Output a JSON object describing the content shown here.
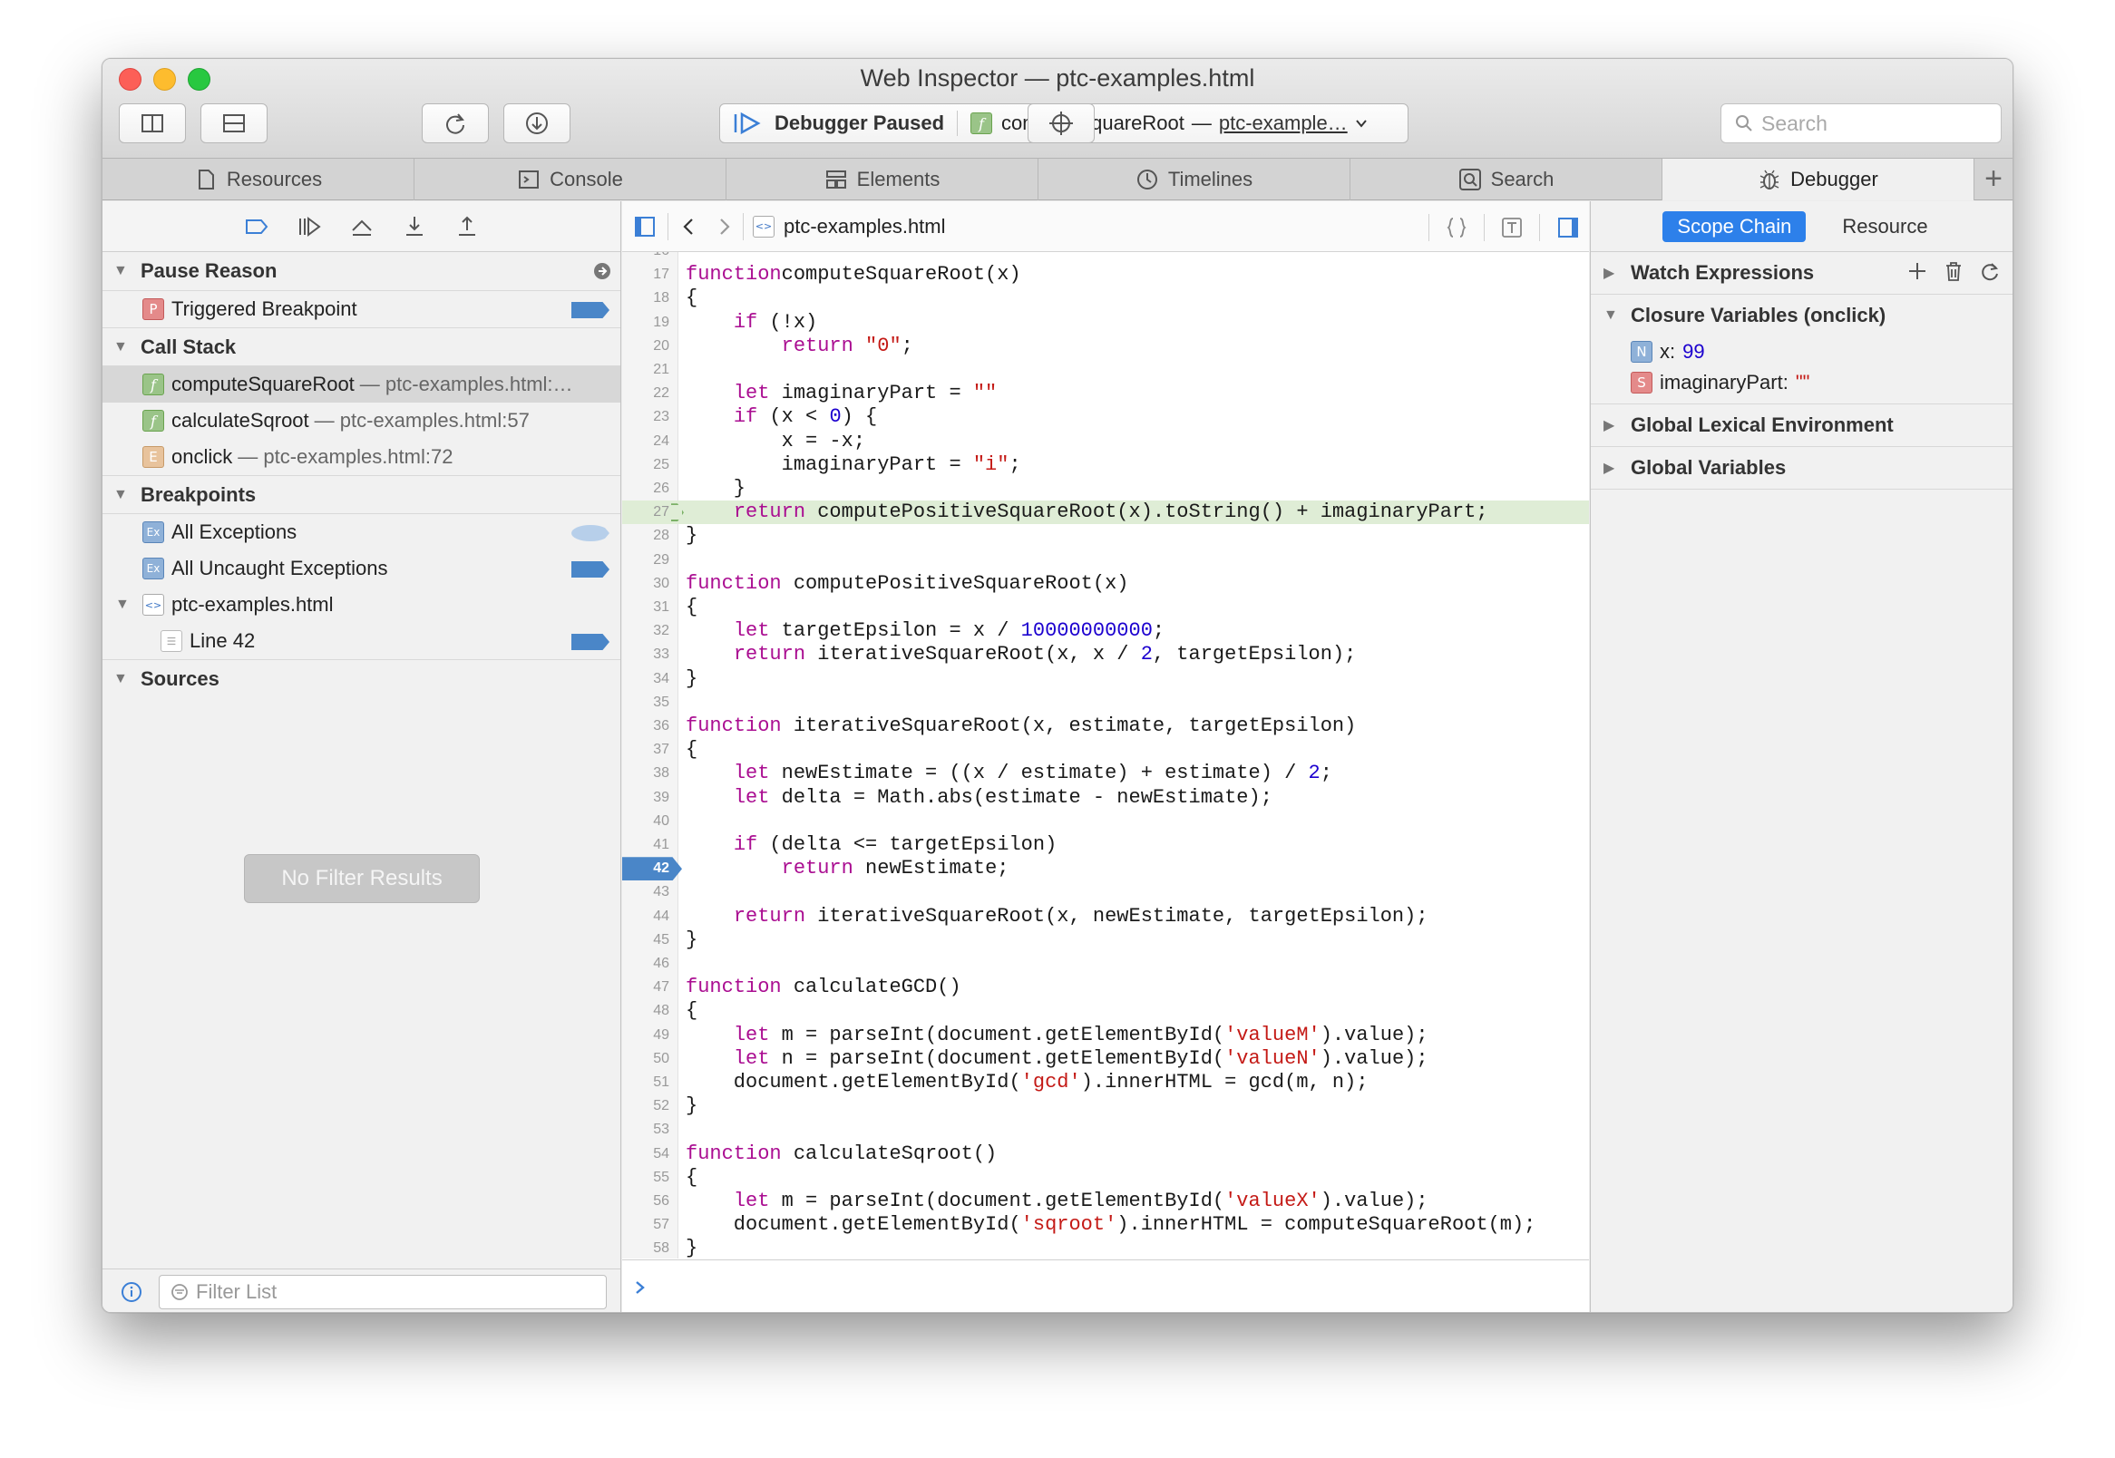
{
  "window": {
    "title": "Web Inspector — ptc-examples.html"
  },
  "toolbar": {
    "debugger_status": "Debugger Paused",
    "current_function": "computeSquareRoot",
    "current_file": "ptc-example…",
    "search_placeholder": "Search"
  },
  "tabs": [
    {
      "label": "Resources",
      "icon": "document-icon"
    },
    {
      "label": "Console",
      "icon": "console-icon"
    },
    {
      "label": "Elements",
      "icon": "elements-icon"
    },
    {
      "label": "Timelines",
      "icon": "clock-icon"
    },
    {
      "label": "Search",
      "icon": "search-icon"
    },
    {
      "label": "Debugger",
      "icon": "bug-icon",
      "active": true
    }
  ],
  "left": {
    "pause_reason": {
      "title": "Pause Reason",
      "item": "Triggered Breakpoint"
    },
    "call_stack": {
      "title": "Call Stack",
      "frames": [
        {
          "name": "computeSquareRoot",
          "loc": "— ptc-examples.html:…",
          "icon": "f",
          "selected": true
        },
        {
          "name": "calculateSqroot",
          "loc": "— ptc-examples.html:57",
          "icon": "f"
        },
        {
          "name": "onclick",
          "loc": "— ptc-examples.html:72",
          "icon": "E"
        }
      ]
    },
    "breakpoints": {
      "title": "Breakpoints",
      "all_exceptions": "All Exceptions",
      "all_uncaught": "All Uncaught Exceptions",
      "file": "ptc-examples.html",
      "line": "Line 42"
    },
    "sources": {
      "title": "Sources",
      "empty": "No Filter Results"
    },
    "filter_placeholder": "Filter List"
  },
  "editor": {
    "file_name": "ptc-examples.html",
    "breakpoint_line": 42,
    "paused_line": 27,
    "first_line": 16,
    "lines": [
      [],
      [
        [
          "kw",
          "function"
        ],
        [
          "",
          "computeSquareRoot(x)"
        ]
      ],
      [
        [
          "",
          "{"
        ]
      ],
      [
        [
          "",
          "    "
        ],
        [
          "kw",
          "if"
        ],
        [
          "",
          " (!x)"
        ]
      ],
      [
        [
          "",
          "        "
        ],
        [
          "kw",
          "return"
        ],
        [
          "",
          " "
        ],
        [
          "str",
          "\"0\""
        ],
        [
          "",
          ";"
        ]
      ],
      [],
      [
        [
          "",
          "    "
        ],
        [
          "kw",
          "let"
        ],
        [
          "",
          " imaginaryPart = "
        ],
        [
          "str",
          "\"\""
        ]
      ],
      [
        [
          "",
          "    "
        ],
        [
          "kw",
          "if"
        ],
        [
          "",
          " (x < "
        ],
        [
          "num",
          "0"
        ],
        [
          "",
          ") {"
        ]
      ],
      [
        [
          "",
          "        x = -x;"
        ]
      ],
      [
        [
          "",
          "        imaginaryPart = "
        ],
        [
          "str",
          "\"i\""
        ],
        [
          "",
          ";"
        ]
      ],
      [
        [
          "",
          "    }"
        ]
      ],
      [
        [
          "",
          "    "
        ],
        [
          "kw",
          "return"
        ],
        [
          "",
          " computePositiveSquareRoot(x).toString() + imaginaryPart;"
        ]
      ],
      [
        [
          "",
          "}"
        ]
      ],
      [],
      [
        [
          "kw",
          "function"
        ],
        [
          "",
          " computePositiveSquareRoot(x)"
        ]
      ],
      [
        [
          "",
          "{"
        ]
      ],
      [
        [
          "",
          "    "
        ],
        [
          "kw",
          "let"
        ],
        [
          "",
          " targetEpsilon = x / "
        ],
        [
          "num",
          "10000000000"
        ],
        [
          "",
          ";"
        ]
      ],
      [
        [
          "",
          "    "
        ],
        [
          "kw",
          "return"
        ],
        [
          "",
          " iterativeSquareRoot(x, x / "
        ],
        [
          "num",
          "2"
        ],
        [
          "",
          ", targetEpsilon);"
        ]
      ],
      [
        [
          "",
          "}"
        ]
      ],
      [],
      [
        [
          "kw",
          "function"
        ],
        [
          "",
          " iterativeSquareRoot(x, estimate, targetEpsilon)"
        ]
      ],
      [
        [
          "",
          "{"
        ]
      ],
      [
        [
          "",
          "    "
        ],
        [
          "kw",
          "let"
        ],
        [
          "",
          " newEstimate = ((x / estimate) + estimate) / "
        ],
        [
          "num",
          "2"
        ],
        [
          "",
          ";"
        ]
      ],
      [
        [
          "",
          "    "
        ],
        [
          "kw",
          "let"
        ],
        [
          "",
          " delta = Math.abs(estimate - newEstimate);"
        ]
      ],
      [],
      [
        [
          "",
          "    "
        ],
        [
          "kw",
          "if"
        ],
        [
          "",
          " (delta <= targetEpsilon)"
        ]
      ],
      [
        [
          "",
          "        "
        ],
        [
          "kw",
          "return"
        ],
        [
          "",
          " newEstimate;"
        ]
      ],
      [],
      [
        [
          "",
          "    "
        ],
        [
          "kw",
          "return"
        ],
        [
          "",
          " iterativeSquareRoot(x, newEstimate, targetEpsilon);"
        ]
      ],
      [
        [
          "",
          "}"
        ]
      ],
      [],
      [
        [
          "kw",
          "function"
        ],
        [
          "",
          " calculateGCD()"
        ]
      ],
      [
        [
          "",
          "{"
        ]
      ],
      [
        [
          "",
          "    "
        ],
        [
          "kw",
          "let"
        ],
        [
          "",
          " m = parseInt(document.getElementById("
        ],
        [
          "str",
          "'valueM'"
        ],
        [
          "",
          ").value);"
        ]
      ],
      [
        [
          "",
          "    "
        ],
        [
          "kw",
          "let"
        ],
        [
          "",
          " n = parseInt(document.getElementById("
        ],
        [
          "str",
          "'valueN'"
        ],
        [
          "",
          ").value);"
        ]
      ],
      [
        [
          "",
          "    document.getElementById("
        ],
        [
          "str",
          "'gcd'"
        ],
        [
          "",
          ").innerHTML = gcd(m, n);"
        ]
      ],
      [
        [
          "",
          "}"
        ]
      ],
      [],
      [
        [
          "kw",
          "function"
        ],
        [
          "",
          " calculateSqroot()"
        ]
      ],
      [
        [
          "",
          "{"
        ]
      ],
      [
        [
          "",
          "    "
        ],
        [
          "kw",
          "let"
        ],
        [
          "",
          " m = parseInt(document.getElementById("
        ],
        [
          "str",
          "'valueX'"
        ],
        [
          "",
          ").value);"
        ]
      ],
      [
        [
          "",
          "    document.getElementById("
        ],
        [
          "str",
          "'sqroot'"
        ],
        [
          "",
          ").innerHTML = computeSquareRoot(m);"
        ]
      ],
      [
        [
          "",
          "}"
        ]
      ]
    ]
  },
  "right": {
    "tabs": {
      "scope_chain": "Scope Chain",
      "resource": "Resource"
    },
    "watch": "Watch Expressions",
    "closure": "Closure Variables (onclick)",
    "vars": [
      {
        "type": "N",
        "name": "x:",
        "value": "99",
        "kind": "num"
      },
      {
        "type": "S",
        "name": "imaginaryPart:",
        "value": "\"\"",
        "kind": "str"
      }
    ],
    "global_lexical": "Global Lexical Environment",
    "global_vars": "Global Variables"
  }
}
